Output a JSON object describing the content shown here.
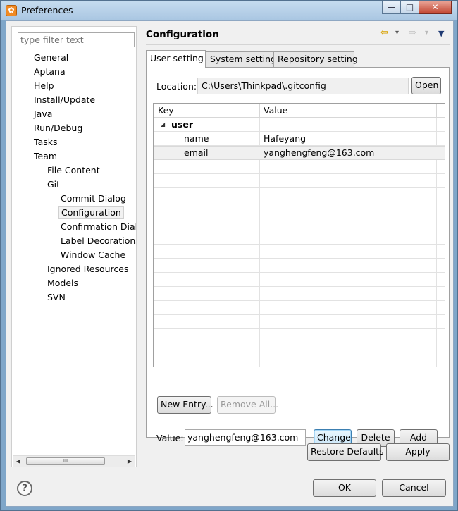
{
  "window": {
    "title": "Preferences",
    "minimize": "—",
    "maximize": "□",
    "close": "✕"
  },
  "filter": {
    "placeholder": "type filter text"
  },
  "tree": {
    "items": [
      {
        "label": "General",
        "level": 0
      },
      {
        "label": "Aptana",
        "level": 0
      },
      {
        "label": "Help",
        "level": 0
      },
      {
        "label": "Install/Update",
        "level": 0
      },
      {
        "label": "Java",
        "level": 0
      },
      {
        "label": "Run/Debug",
        "level": 0
      },
      {
        "label": "Tasks",
        "level": 0
      },
      {
        "label": "Team",
        "level": 0
      },
      {
        "label": "File Content",
        "level": 1
      },
      {
        "label": "Git",
        "level": 1
      },
      {
        "label": "Commit Dialog",
        "level": 2
      },
      {
        "label": "Configuration",
        "level": 2,
        "selected": true
      },
      {
        "label": "Confirmation Dialo",
        "level": 2
      },
      {
        "label": "Label Decorations",
        "level": 2
      },
      {
        "label": "Window Cache",
        "level": 2
      },
      {
        "label": "Ignored Resources",
        "level": 1
      },
      {
        "label": "Models",
        "level": 1
      },
      {
        "label": "SVN",
        "level": 1
      }
    ],
    "scroll_left": "◀",
    "scroll_right": "▶",
    "scroll_grip": "III"
  },
  "page": {
    "title": "Configuration",
    "nav": {
      "back": "⇦",
      "back_menu": "▾",
      "forward": "⇨",
      "forward_menu": "▾",
      "view_menu": "▼"
    }
  },
  "tabs": [
    {
      "label": "User setting",
      "active": true
    },
    {
      "label": "System setting",
      "active": false
    },
    {
      "label": "Repository setting",
      "active": false
    }
  ],
  "location": {
    "label": "Location:",
    "value": "C:\\Users\\Thinkpad\\.gitconfig",
    "open_button": "Open"
  },
  "table": {
    "headers": {
      "key": "Key",
      "value": "Value"
    },
    "expand_glyph": "◢",
    "rows": [
      {
        "key": "user",
        "value": "",
        "section": true,
        "selected": false
      },
      {
        "key": "name",
        "value": "Hafeyang",
        "section": false,
        "selected": false
      },
      {
        "key": "email",
        "value": "yanghengfeng@163.com",
        "section": false,
        "selected": true
      }
    ]
  },
  "entry_buttons": {
    "new_entry": "New Entry...",
    "remove_all": "Remove All..."
  },
  "value_editor": {
    "label": "Value:",
    "value": "yanghengfeng@163.com",
    "change": "Change",
    "delete": "Delete",
    "add": "Add"
  },
  "page_buttons": {
    "restore_defaults": "Restore Defaults",
    "apply": "Apply"
  },
  "dialog_buttons": {
    "help": "?",
    "ok": "OK",
    "cancel": "Cancel"
  }
}
